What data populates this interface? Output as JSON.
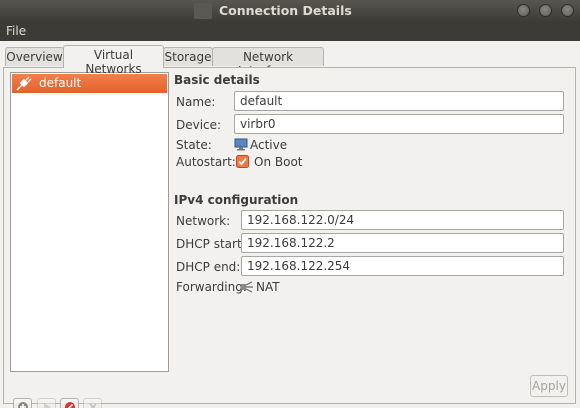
{
  "window": {
    "title": "Connection Details"
  },
  "menu": {
    "file": "File"
  },
  "tabs": [
    {
      "label": "Overview"
    },
    {
      "label": "Virtual Networks",
      "active": true
    },
    {
      "label": "Storage"
    },
    {
      "label": "Network Interfaces"
    }
  ],
  "networks": [
    {
      "name": "default",
      "selected": true
    }
  ],
  "basic": {
    "title": "Basic details",
    "name_label": "Name:",
    "name_value": "default",
    "device_label": "Device:",
    "device_value": "virbr0",
    "state_label": "State:",
    "state_value": "Active",
    "autostart_label": "Autostart:",
    "autostart_value": "On Boot",
    "autostart_checked": true
  },
  "ipv4": {
    "title": "IPv4 configuration",
    "network_label": "Network:",
    "network_value": "192.168.122.0/24",
    "dhcp_start_label": "DHCP start:",
    "dhcp_start_value": "192.168.122.2",
    "dhcp_end_label": "DHCP end:",
    "dhcp_end_value": "192.168.122.254",
    "forwarding_label": "Forwarding:",
    "forwarding_value": "NAT"
  },
  "buttons": {
    "apply": "Apply"
  },
  "colors": {
    "selection": "#e95420",
    "titlebar": "#3c3b37",
    "window_bg": "#f2f1f0"
  }
}
